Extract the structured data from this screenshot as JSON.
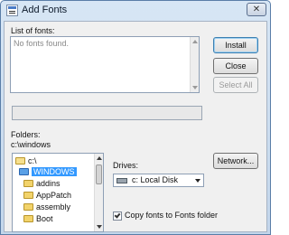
{
  "window": {
    "title": "Add Fonts",
    "close_glyph": "✕"
  },
  "fonts_list": {
    "label": "List of fonts:",
    "empty_message": "No fonts found."
  },
  "buttons": {
    "install": "Install",
    "close": "Close",
    "select_all": "Select All",
    "network": "Network..."
  },
  "folders": {
    "label": "Folders:",
    "current_path": "c:\\windows",
    "items": [
      {
        "label": "c:\\",
        "icon": "folder-open-icon"
      },
      {
        "label": "WINDOWS",
        "icon": "folder-open-icon",
        "selected": true
      },
      {
        "label": "addins",
        "icon": "folder-icon"
      },
      {
        "label": "AppPatch",
        "icon": "folder-icon"
      },
      {
        "label": "assembly",
        "icon": "folder-icon"
      },
      {
        "label": "Boot",
        "icon": "folder-icon"
      }
    ]
  },
  "drives": {
    "label": "Drives:",
    "selected": "c: Local Disk",
    "icon": "hard-drive-icon"
  },
  "copy_option": {
    "label": "Copy fonts to Fonts folder",
    "checked": true
  },
  "colors": {
    "title_bar": "#c3d6eb",
    "selection": "#3399ff",
    "dialog_background": "#f0f0f0"
  }
}
